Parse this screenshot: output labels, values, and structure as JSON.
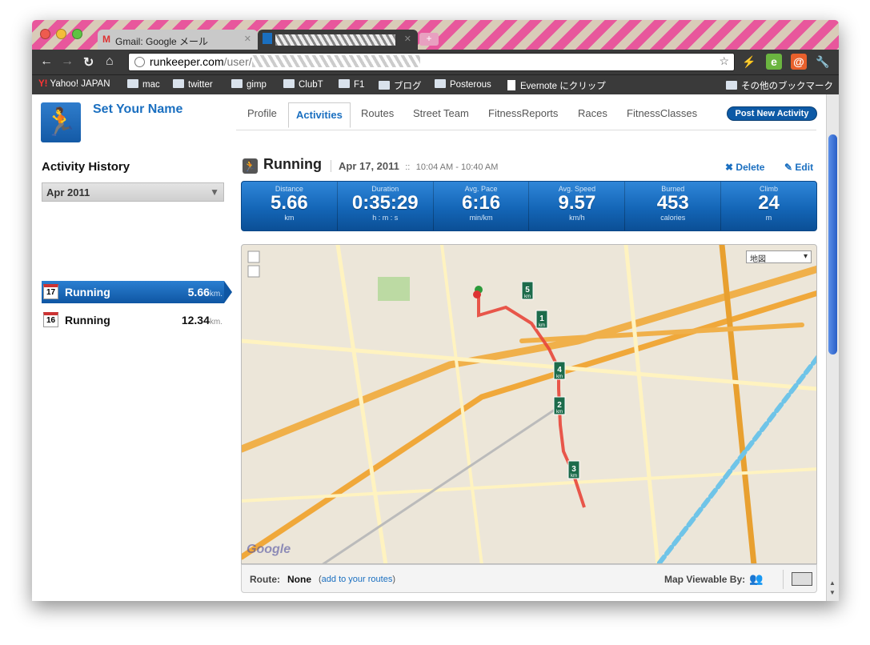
{
  "browser": {
    "tabs": [
      {
        "label": "Gmail: Google メール",
        "active": false
      },
      {
        "label": "",
        "active": true
      }
    ],
    "url": {
      "host": "runkeeper.com",
      "path": "/user/"
    },
    "bookmarks": [
      "Yahoo! JAPAN",
      "mac",
      "twitter",
      "gimp",
      "ClubT",
      "F1",
      "ブログ",
      "Posterous",
      "Evernote にクリップ"
    ],
    "bookmarks_other": "その他のブックマーク"
  },
  "header": {
    "username": "Set Your Name",
    "nav": [
      "Profile",
      "Activities",
      "Routes",
      "Street Team",
      "FitnessReports",
      "Races",
      "FitnessClasses"
    ],
    "post_button": "Post New Activity"
  },
  "sidebar": {
    "title": "Activity History",
    "month": "Apr 2011",
    "items": [
      {
        "day": "17",
        "label": "Running",
        "distance": "5.66",
        "unit": "km.",
        "selected": true
      },
      {
        "day": "16",
        "label": "Running",
        "distance": "12.34",
        "unit": "km.",
        "selected": false
      }
    ]
  },
  "activity": {
    "title": "Running",
    "date": "Apr 17, 2011",
    "separator": "::",
    "time": "10:04 AM - 10:40 AM",
    "delete": "Delete",
    "edit": "Edit",
    "stats": [
      {
        "label": "Distance",
        "value": "5.66",
        "unit": "km"
      },
      {
        "label": "Duration",
        "value": "0:35:29",
        "unit": "h : m : s"
      },
      {
        "label": "Avg. Pace",
        "value": "6:16",
        "unit": "min/km"
      },
      {
        "label": "Avg. Speed",
        "value": "9.57",
        "unit": "km/h"
      },
      {
        "label": "Burned",
        "value": "453",
        "unit": "calories"
      },
      {
        "label": "Climb",
        "value": "24",
        "unit": "m"
      }
    ]
  },
  "map": {
    "type_select": "地図",
    "markers": [
      "5",
      "1",
      "4",
      "2",
      "3"
    ],
    "marker_unit": "km",
    "attribution": "Google"
  },
  "route_bar": {
    "label": "Route:",
    "value": "None",
    "add_prefix": "(",
    "add_link": "add to your routes",
    "add_suffix": ")",
    "viewable_label": "Map Viewable By:"
  },
  "colors": {
    "accent": "#1a6fc0",
    "stats_bg": "#1466b7",
    "route": "#e8463a"
  }
}
